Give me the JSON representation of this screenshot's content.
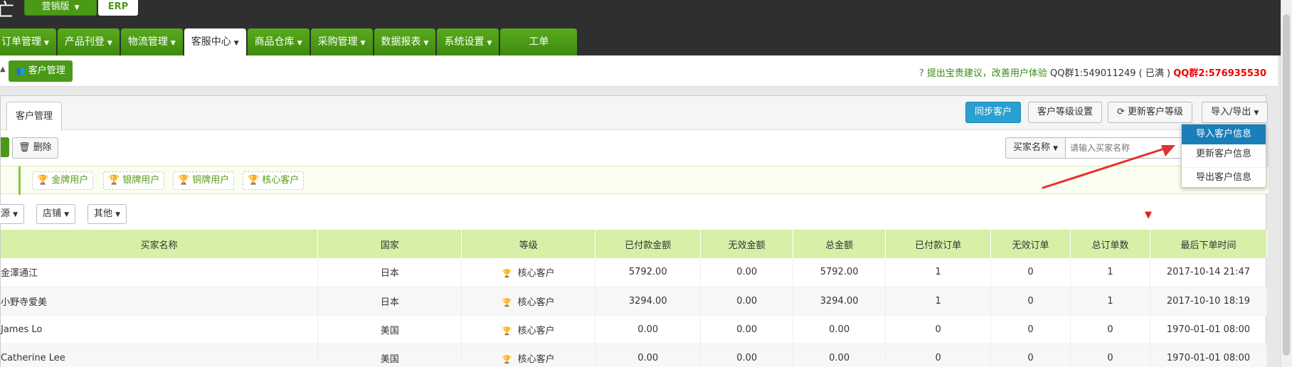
{
  "top": {
    "logo_fragment": "亡",
    "edition_label": "营销版",
    "erp_label": "ERP"
  },
  "nav": {
    "items": [
      {
        "label": "订单管理",
        "active": false
      },
      {
        "label": "产品刊登",
        "active": false
      },
      {
        "label": "物流管理",
        "active": false
      },
      {
        "label": "客服中心",
        "active": true
      },
      {
        "label": "商品仓库",
        "active": false
      },
      {
        "label": "采购管理",
        "active": false
      },
      {
        "label": "数据报表",
        "active": false
      },
      {
        "label": "系统设置",
        "active": false
      },
      {
        "label": "工单",
        "active": false
      }
    ]
  },
  "subbar": {
    "customer_manage_button": "客户管理",
    "notice_suggest": "提出宝贵建议，改善用户体验",
    "notice_qq1": "QQ群1:549011249 ( 已满 )",
    "notice_qq2": "QQ群2:576935530"
  },
  "panel": {
    "tab_label": "客户管理",
    "sync_button": "同步客户",
    "level_setting_button": "客户等级设置",
    "update_level_button": "更新客户等级",
    "import_export_button": "导入/导出",
    "delete_button": "删除",
    "search_field_select": "买家名称",
    "search_placeholder": "请输入买家名称"
  },
  "levels": [
    {
      "label": "金牌用户"
    },
    {
      "label": "银牌用户"
    },
    {
      "label": "铜牌用户"
    },
    {
      "label": "核心客户"
    }
  ],
  "filters": {
    "source": "来源",
    "shop": "店铺",
    "other": "其他"
  },
  "dropdown": {
    "items": [
      {
        "label": "导入客户信息",
        "active": true
      },
      {
        "label": "更新客户信息",
        "active": false
      },
      {
        "label": "导出客户信息",
        "active": false
      }
    ]
  },
  "table": {
    "headers": [
      "买家名称",
      "国家",
      "等级",
      "已付款金额",
      "无效金额",
      "总金额",
      "已付款订单",
      "无效订单",
      "总订单数",
      "最后下单时间"
    ],
    "rows": [
      [
        "金澤通江",
        "日本",
        "核心客户",
        "5792.00",
        "0.00",
        "5792.00",
        "1",
        "0",
        "1",
        "2017-10-14 21:47"
      ],
      [
        "小野寺爱美",
        "日本",
        "核心客户",
        "3294.00",
        "0.00",
        "3294.00",
        "1",
        "0",
        "1",
        "2017-10-10 18:19"
      ],
      [
        "James Lo",
        "美国",
        "核心客户",
        "0.00",
        "0.00",
        "0.00",
        "0",
        "0",
        "0",
        "1970-01-01 08:00"
      ],
      [
        "Catherine Lee",
        "美国",
        "核心客户",
        "0.00",
        "0.00",
        "0.00",
        "0",
        "0",
        "0",
        "1970-01-01 08:00"
      ]
    ]
  },
  "colors": {
    "brand_green": "#4a9a18",
    "primary_blue": "#2aa0d0",
    "header_green": "#d6f0a8",
    "alert_red": "#e00000"
  }
}
